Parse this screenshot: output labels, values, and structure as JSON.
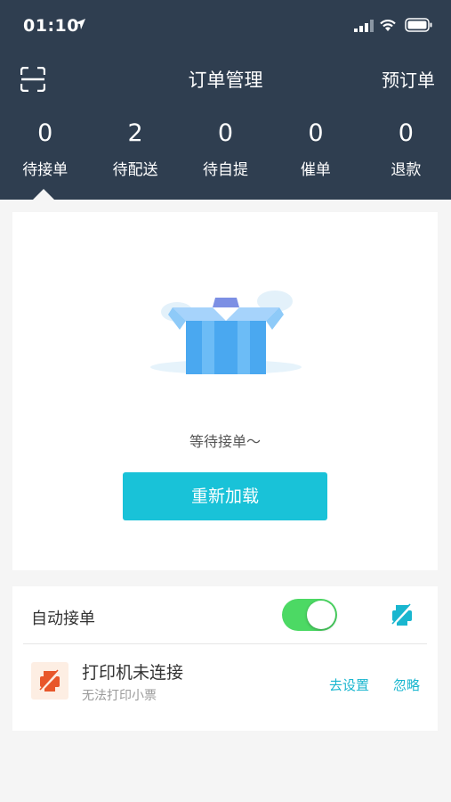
{
  "status_bar": {
    "time": "01:10"
  },
  "nav": {
    "title": "订单管理",
    "right_label": "预订单"
  },
  "stats": [
    {
      "value": "0",
      "label": "待接单"
    },
    {
      "value": "2",
      "label": "待配送"
    },
    {
      "value": "0",
      "label": "待自提"
    },
    {
      "value": "0",
      "label": "催单"
    },
    {
      "value": "0",
      "label": "退款"
    }
  ],
  "empty": {
    "message": "等待接单～",
    "reload_label": "重新加载"
  },
  "auto_accept": {
    "label": "自动接单",
    "enabled": true
  },
  "printer": {
    "title": "打印机未连接",
    "subtitle": "无法打印小票",
    "setup_label": "去设置",
    "ignore_label": "忽略"
  },
  "colors": {
    "header_bg": "#2f3e50",
    "accent": "#19c2d8",
    "toggle_on": "#4cd964",
    "warn_orange": "#e8572a"
  }
}
